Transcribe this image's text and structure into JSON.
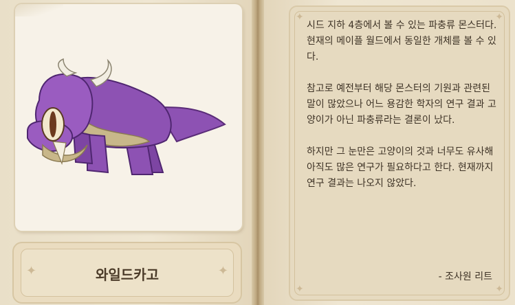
{
  "monster": {
    "name": "와일드카고",
    "image_icon": "purple-lizard-monster-sprite",
    "description": "시드 지하 4층에서 볼 수 있는 파충류 몬스터다. 현재의 메이플 월드에서 동일한 개체를 볼 수 있다.\n\n참고로 예전부터 해당 몬스터의 기원과 관련된 말이 많았으나 어느 용감한 학자의 연구 결과 고양이가 아닌 파충류라는 결론이 났다.\n\n하지만 그 눈만은 고양이의 것과 너무도 유사해 아직도 많은 연구가 필요하다고 한다. 현재까지 연구 결과는 나오지 않았다.",
    "author": "- 조사원 리트"
  },
  "colors": {
    "page": "#efe6d2",
    "text": "#3e3326",
    "monster_body": "#8a4fb0",
    "monster_belly": "#c9b98e"
  }
}
